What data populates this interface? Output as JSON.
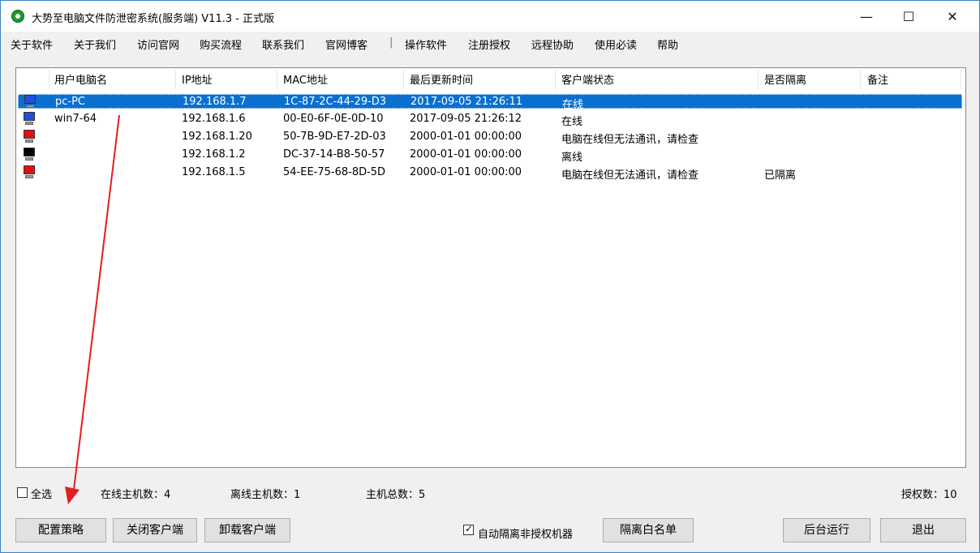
{
  "window": {
    "title": "大势至电脑文件防泄密系统(服务端) V11.3 - 正式版",
    "controls": {
      "minimize": "—",
      "maximize": "☐",
      "close": "✕"
    }
  },
  "menu": [
    "关于软件",
    "关于我们",
    "访问官网",
    "购买流程",
    "联系我们",
    "官网博客",
    "操作软件",
    "注册授权",
    "远程协助",
    "使用必读",
    "帮助"
  ],
  "menu_separator": "|",
  "list": {
    "columns": [
      "用户电脑名",
      "IP地址",
      "MAC地址",
      "最后更新时间",
      "客户端状态",
      "是否隔离",
      "备注"
    ],
    "rows": [
      {
        "icon": "pc-online-icon",
        "icon_color": "#1f4fe0",
        "name": "pc-PC",
        "ip": "192.168.1.7",
        "mac": "1C-87-2C-44-29-D3",
        "time": "2017-09-05 21:26:11",
        "status": "在线",
        "isolated": "",
        "note": "",
        "selected": true
      },
      {
        "icon": "pc-online-icon",
        "icon_color": "#1f4fe0",
        "name": "win7-64",
        "ip": "192.168.1.6",
        "mac": "00-E0-6F-0E-0D-10",
        "time": "2017-09-05 21:26:12",
        "status": "在线",
        "isolated": "",
        "note": "",
        "selected": false
      },
      {
        "icon": "pc-warning-icon",
        "icon_color": "#e01010",
        "name": "",
        "ip": "192.168.1.20",
        "mac": "50-7B-9D-E7-2D-03",
        "time": "2000-01-01 00:00:00",
        "status": "电脑在线但无法通讯，请检查",
        "isolated": "",
        "note": "",
        "selected": false
      },
      {
        "icon": "pc-offline-icon",
        "icon_color": "#000000",
        "name": "",
        "ip": "192.168.1.2",
        "mac": "DC-37-14-B8-50-57",
        "time": "2000-01-01 00:00:00",
        "status": "离线",
        "isolated": "",
        "note": "",
        "selected": false
      },
      {
        "icon": "pc-warning-icon",
        "icon_color": "#e01010",
        "name": "",
        "ip": "192.168.1.5",
        "mac": "54-EE-75-68-8D-5D",
        "time": "2000-01-01 00:00:00",
        "status": "电脑在线但无法通讯，请检查",
        "isolated": "已隔离",
        "note": "",
        "selected": false
      }
    ]
  },
  "footer": {
    "select_all_label": "全选",
    "online_label": "在线主机数：4",
    "offline_label": "离线主机数：1",
    "total_label": "主机总数：5",
    "license_label": "授权数：10",
    "auto_isolate_label": "自动隔离非授权机器",
    "auto_isolate_checked": true,
    "buttons": {
      "config_policy": "配置策略",
      "close_client": "关闭客户端",
      "uninstall_client": "卸载客户端",
      "isolate_whitelist": "隔离白名单",
      "run_background": "后台运行",
      "exit": "退出"
    }
  },
  "colors": {
    "selection": "#0a6fcf",
    "annotation_arrow": "#e02020"
  }
}
